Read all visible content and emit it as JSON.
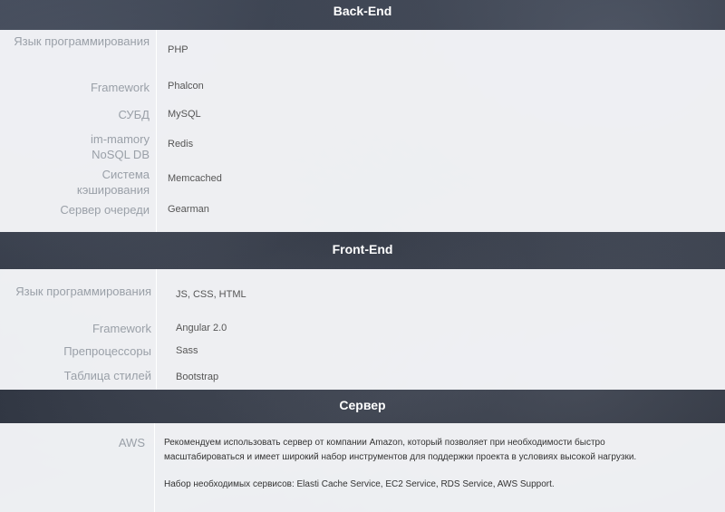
{
  "sections": [
    {
      "title": "Back-End",
      "rows": [
        {
          "label": "Язык программирования",
          "value": "PHP"
        },
        {
          "label": "Framework",
          "value": "Phalcon"
        },
        {
          "label": "СУБД",
          "value": "MySQL"
        },
        {
          "label": "im-mamory NoSQL DB",
          "value": "Redis"
        },
        {
          "label": "Система кэширования",
          "value": "Memcached"
        },
        {
          "label": "Сервер очереди",
          "value": "Gearman"
        }
      ]
    },
    {
      "title": "Front-End",
      "rows": [
        {
          "label": "Язык программирования",
          "value": "JS, CSS, HTML"
        },
        {
          "label": "Framework",
          "value": "Angular 2.0"
        },
        {
          "label": "Препроцессоры",
          "value": "Sass"
        },
        {
          "label": "Таблица стилей",
          "value": "Bootstrap"
        }
      ]
    },
    {
      "title": "Сервер",
      "rows": [
        {
          "label": "AWS",
          "paragraphs": [
            "Рекомендуем использовать сервер от компании Amazon, который позволяет при необходимости быстро масштабироваться и имеет широкий набор инструментов для поддержки проекта в условиях высокой нагрузки.",
            "Набор необходимых сервисов: Elasti Cache Service, EC2 Service, RDS Service, AWS Support."
          ]
        }
      ]
    }
  ]
}
